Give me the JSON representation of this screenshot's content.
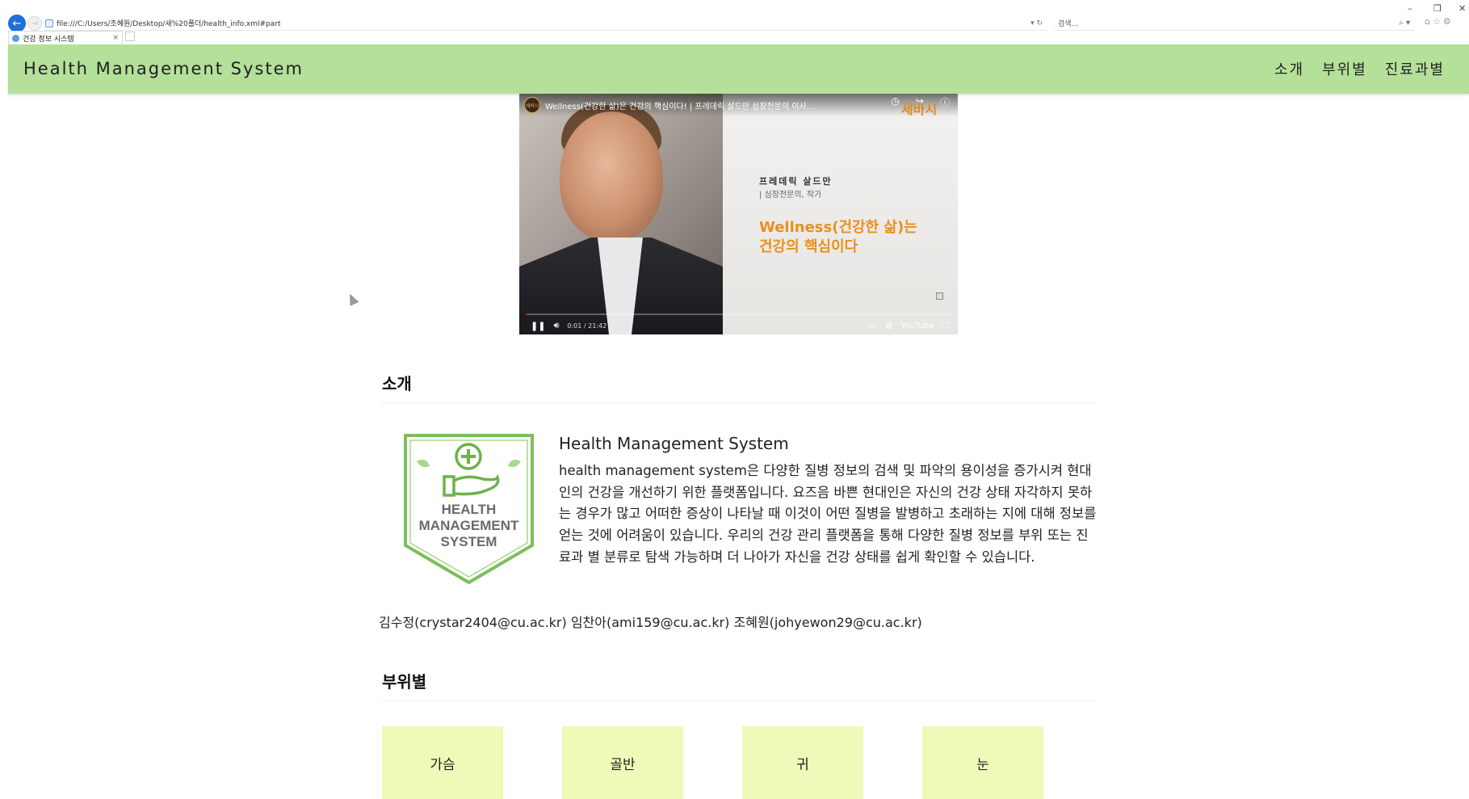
{
  "browser": {
    "address": "file:///C:/Users/조혜원/Desktop/새%20폴더/health_info.xml#part",
    "search_placeholder": "검색...",
    "tab_title": "건강 정보 시스템",
    "tab_close": "×",
    "win_min": "–",
    "win_restore": "❐",
    "win_close": "✕"
  },
  "header": {
    "brand": "Health Management System",
    "menu": [
      {
        "label": "소개"
      },
      {
        "label": "부위별"
      },
      {
        "label": "진료과별"
      }
    ]
  },
  "video": {
    "title": "Wellness(건강한 삶)은 건강의 핵심이다! | 프레데릭 살드만 심장전문의 이사...",
    "channel_logo": "세바시",
    "brand": "세바시",
    "speaker_name": "프레데릭 살드만",
    "speaker_role": "| 심장전문의, 작가",
    "quote_line1": "Wellness(건강한 삶)는",
    "quote_line2": "건강의 핵심이다",
    "time": "0:01 / 21:42",
    "youtube_label": "YouTube"
  },
  "intro": {
    "section_title": "소개",
    "logo_line1": "HEALTH",
    "logo_line2": "MANAGEMENT",
    "logo_line3": "SYSTEM",
    "heading": "Health Management System",
    "body": "health management system은 다양한 질병 정보의 검색 및 파악의 용이성을 증가시켜 현대인의 건강을 개선하기 위한 플랫폼입니다. 요즈음 바쁜 현대인은 자신의 건강 상태 자각하지 못하는 경우가 많고 어떠한 증상이 나타날 때 이것이 어떤 질병을 발병하고 초래하는 지에 대해 정보를 얻는 것에 어려움이 있습니다. 우리의 건강 관리 플랫폼을 통해 다양한 질병 정보를 부위 또는 진료과 별 분류로 탐색 가능하며 더 나아가 자신을 건강 상태를 쉽게 확인할 수 있습니다.",
    "authors": "김수정(crystar2404@cu.ac.kr) 임찬아(ami159@cu.ac.kr) 조혜원(johyewon29@cu.ac.kr)"
  },
  "body_parts": {
    "section_title": "부위별",
    "items": [
      {
        "label": "가슴"
      },
      {
        "label": "골반"
      },
      {
        "label": "귀"
      },
      {
        "label": "눈"
      }
    ]
  },
  "colors": {
    "header_bg": "#b4e09a",
    "card_bg": "#eefbb8",
    "logo_green": "#7cbf5a",
    "video_accent": "#e8901e"
  }
}
